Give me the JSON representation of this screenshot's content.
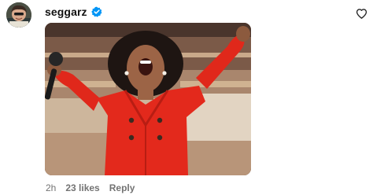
{
  "comment": {
    "username": "seggarz",
    "verified": true,
    "verified_color": "#0095f6",
    "time": "2h",
    "likes": "23 likes",
    "reply_label": "Reply",
    "like_icon": "heart-outline-icon",
    "media_type": "gif-reaction-image"
  }
}
